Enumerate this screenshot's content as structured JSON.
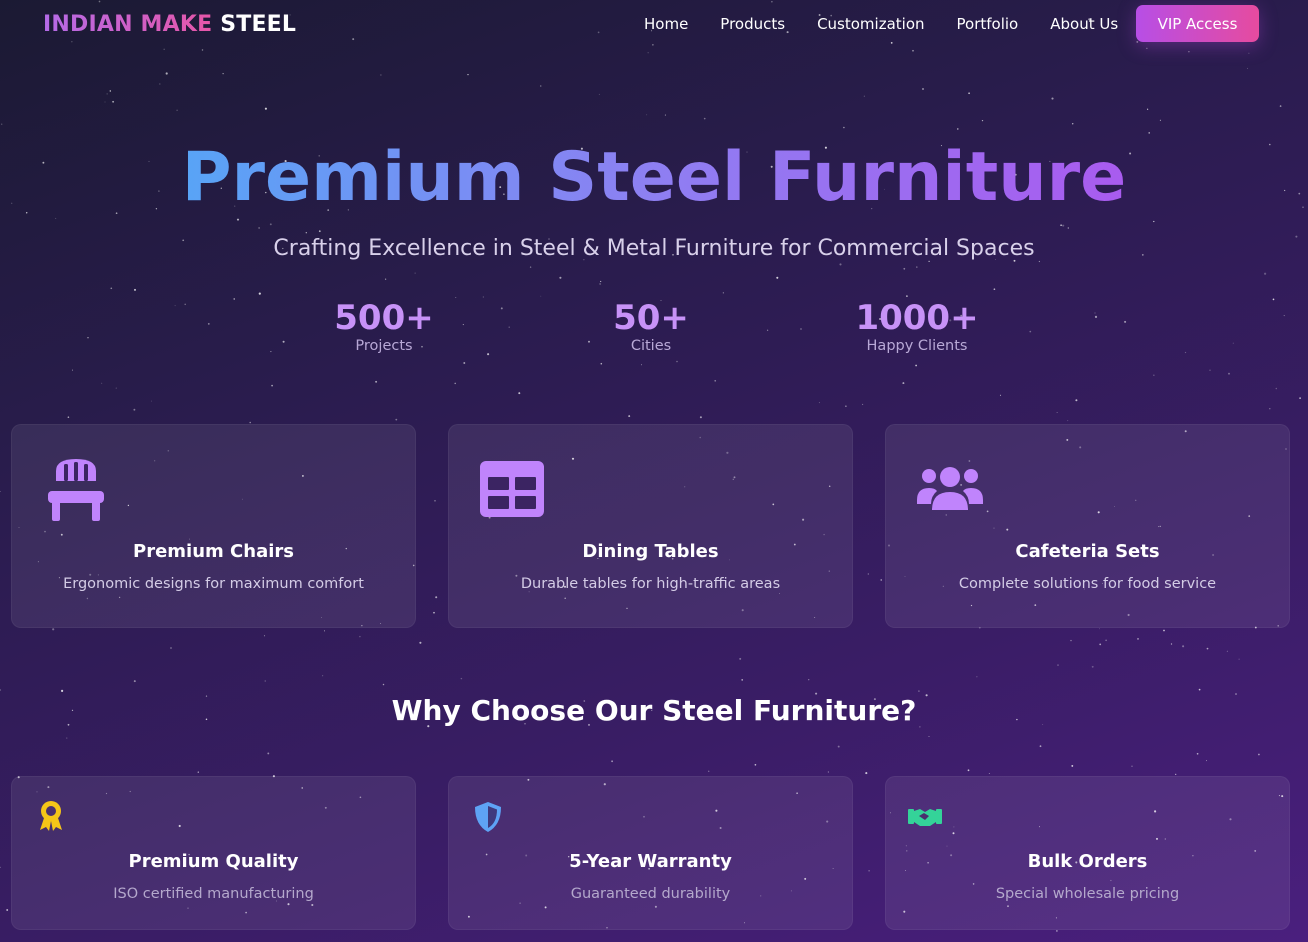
{
  "nav": {
    "logo_part1": "INDIAN MAKE",
    "logo_part2": "STEEL",
    "items": [
      "Home",
      "Products",
      "Customization",
      "Portfolio",
      "About Us"
    ],
    "cta": "VIP Access"
  },
  "hero": {
    "title": "Premium Steel Furniture",
    "subtitle": "Crafting Excellence in Steel & Metal Furniture for Commercial Spaces",
    "stats": [
      {
        "value": "500+",
        "label": "Projects"
      },
      {
        "value": "50+",
        "label": "Cities"
      },
      {
        "value": "1000+",
        "label": "Happy Clients"
      }
    ]
  },
  "categories": [
    {
      "icon": "chair-icon",
      "title": "Premium Chairs",
      "desc": "Ergonomic designs for maximum comfort"
    },
    {
      "icon": "table-icon",
      "title": "Dining Tables",
      "desc": "Durable tables for high-traffic areas"
    },
    {
      "icon": "users-icon",
      "title": "Cafeteria Sets",
      "desc": "Complete solutions for food service"
    }
  ],
  "why": {
    "heading": "Why Choose Our Steel Furniture?",
    "features": [
      {
        "icon": "award-icon",
        "title": "Premium Quality",
        "desc": "ISO certified manufacturing"
      },
      {
        "icon": "shield-icon",
        "title": "5-Year Warranty",
        "desc": "Guaranteed durability"
      },
      {
        "icon": "handshake-icon",
        "title": "Bulk Orders",
        "desc": "Special wholesale pricing"
      }
    ]
  },
  "colors": {
    "accent_purple": "#c084fc",
    "brand_pink": "#e756a8",
    "award_gold": "#f5c518",
    "shield_blue": "#5ea3f5",
    "handshake_green": "#34d399"
  }
}
